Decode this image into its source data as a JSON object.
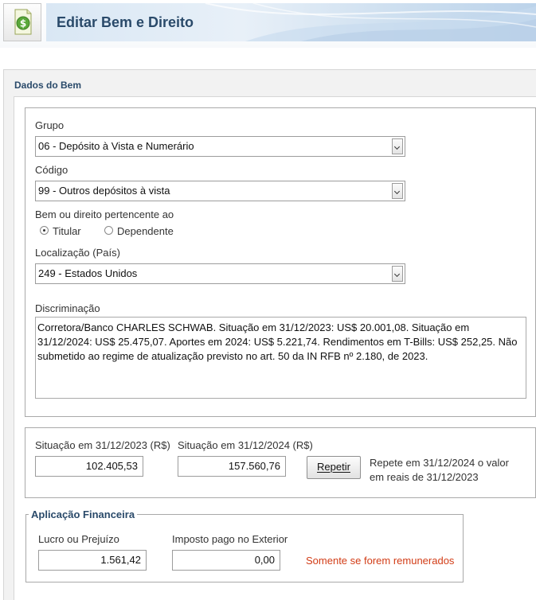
{
  "header": {
    "title": "Editar Bem e Direito",
    "icon": "money-document-icon"
  },
  "section": {
    "title": "Dados do Bem"
  },
  "form": {
    "grupo_label": "Grupo",
    "grupo_value": "06 - Depósito à Vista e Numerário",
    "codigo_label": "Código",
    "codigo_value": "99 - Outros depósitos à vista",
    "pertencente_label": "Bem ou direito pertencente ao",
    "titular_label": "Titular",
    "dependente_label": "Dependente",
    "selected_owner": "Titular",
    "localizacao_label": "Localização (País)",
    "localizacao_value": "249 - Estados Unidos",
    "discriminacao_label": "Discriminação",
    "discriminacao_value": "Corretora/Banco CHARLES SCHWAB. Situação em 31/12/2023: US$ 20.001,08. Situação em 31/12/2024: US$ 25.475,07. Aportes em 2024: US$ 5.221,74. Rendimentos em T-Bills: US$ 252,25. Não submetido ao regime de atualização previsto no art. 50 da IN RFB nº 2.180, de 2023."
  },
  "situacao": {
    "label_2023": "Situação em 31/12/2023 (R$)",
    "value_2023": "102.405,53",
    "label_2024": "Situação em 31/12/2024 (R$)",
    "value_2024": "157.560,76",
    "repeat_button": "Repetir",
    "repeat_hint_line1": "Repete em 31/12/2024 o valor",
    "repeat_hint_line2": "em reais de 31/12/2023"
  },
  "aplicacao": {
    "legend": "Aplicação Financeira",
    "lucro_label": "Lucro ou Prejuízo",
    "lucro_value": "1.561,42",
    "imposto_label": "Imposto pago no Exterior",
    "imposto_value": "0,00",
    "note": "Somente se forem remunerados"
  },
  "colors": {
    "title": "#2a4a6a",
    "note_red": "#d23c16",
    "banner": "#d9e7f4"
  }
}
